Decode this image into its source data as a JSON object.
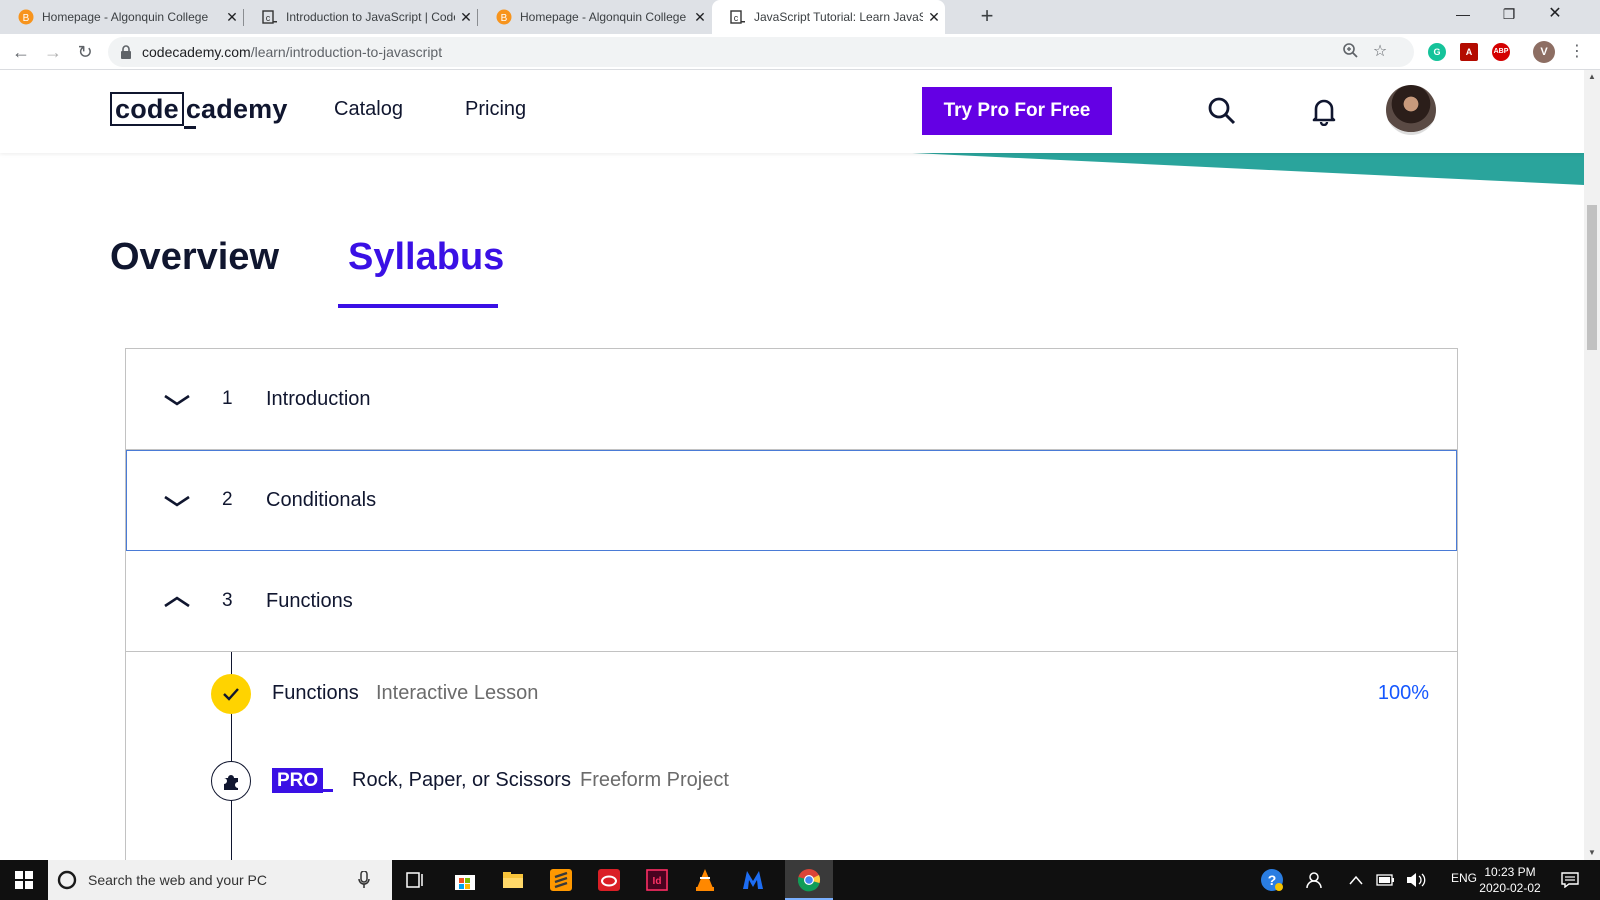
{
  "browser": {
    "tabs": [
      {
        "title": "Homepage - Algonquin College",
        "icon": "algonquin-favicon",
        "active": false
      },
      {
        "title": "Introduction to JavaScript | Code",
        "icon": "codecademy-favicon",
        "active": false
      },
      {
        "title": "Homepage - Algonquin College",
        "icon": "algonquin-favicon",
        "active": false
      },
      {
        "title": "JavaScript Tutorial: Learn JavaScri",
        "icon": "codecademy-favicon",
        "active": true
      }
    ],
    "new_tab_label": "+",
    "url_host": "codecademy.com",
    "url_path": "/learn/introduction-to-javascript",
    "profile_initial": "V",
    "extensions": [
      "grammarly-icon",
      "pdf-icon",
      "adblock-icon"
    ],
    "abp_label": "ABP"
  },
  "site": {
    "logo_box": "code",
    "logo_rest": "cademy",
    "nav": [
      "Catalog",
      "Pricing"
    ],
    "cta": "Try Pro For Free",
    "accent": "#6400e4"
  },
  "course_tabs": {
    "overview": "Overview",
    "syllabus": "Syllabus",
    "active": "Syllabus"
  },
  "syllabus": {
    "modules": [
      {
        "num": "1",
        "label": "Introduction",
        "expanded": false
      },
      {
        "num": "2",
        "label": "Conditionals",
        "expanded": false
      },
      {
        "num": "3",
        "label": "Functions",
        "expanded": true
      }
    ],
    "lessons": [
      {
        "name": "Functions",
        "type": "Interactive Lesson",
        "progress": "100%",
        "status": "complete"
      },
      {
        "name": "Rock, Paper, or Scissors",
        "type": "Freeform Project",
        "badge": "PRO",
        "status": "locked"
      }
    ]
  },
  "taskbar": {
    "search_placeholder": "Search the web and your PC",
    "language": "ENG",
    "time": "10:23 PM",
    "date": "2020-02-02"
  }
}
